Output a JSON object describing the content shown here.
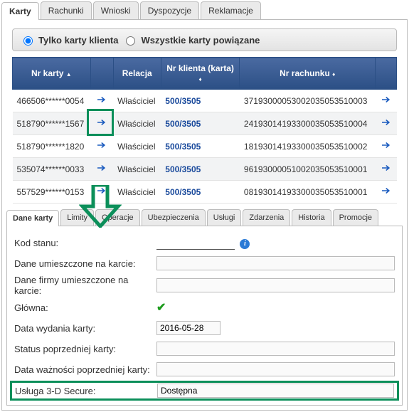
{
  "topTabs": {
    "karty": "Karty",
    "rachunki": "Rachunki",
    "wnioski": "Wnioski",
    "dyspozycje": "Dyspozycje",
    "reklamacje": "Reklamacje"
  },
  "filter": {
    "onlyClient": "Tylko karty klienta",
    "allLinked": "Wszystkie karty powiązane"
  },
  "table": {
    "headers": {
      "cardNo": "Nr karty",
      "relation": "Relacja",
      "clientNo": "Nr klienta (karta)",
      "accountNo": "Nr rachunku"
    },
    "rows": [
      {
        "card": "466506******0054",
        "relation": "Właściciel",
        "client": "500/3505",
        "account": "37193000053002035053510003"
      },
      {
        "card": "518790******1567",
        "relation": "Właściciel",
        "client": "500/3505",
        "account": "24193014193300035053510004"
      },
      {
        "card": "518790******1820",
        "relation": "Właściciel",
        "client": "500/3505",
        "account": "18193014193300035053510002"
      },
      {
        "card": "535074******0033",
        "relation": "Właściciel",
        "client": "500/3505",
        "account": "96193000051002035053510001"
      },
      {
        "card": "557529******0153",
        "relation": "Właściciel",
        "client": "500/3505",
        "account": "08193014193300035053510001"
      }
    ]
  },
  "detailTabs": {
    "daneKarty": "Dane karty",
    "limity": "Limity",
    "operacje": "Operacje",
    "ubezpieczenia": "Ubezpieczenia",
    "uslugi": "Usługi",
    "zdarzenia": "Zdarzenia",
    "historia": "Historia",
    "promocje": "Promocje"
  },
  "details": {
    "kodStanu": {
      "label": "Kod stanu:",
      "value": ""
    },
    "daneKarcie": {
      "label": "Dane umieszczone na karcie:",
      "value": ""
    },
    "daneFirmy": {
      "label": "Dane firmy umieszczone na karcie:",
      "value": ""
    },
    "glowna": {
      "label": "Główna:",
      "value": "✔"
    },
    "dataWydania": {
      "label": "Data wydania karty:",
      "value": "2016-05-28"
    },
    "statusPoprzedniej": {
      "label": "Status poprzedniej karty:",
      "value": ""
    },
    "dataWaznosci": {
      "label": "Data ważności poprzedniej karty:",
      "value": ""
    },
    "secure": {
      "label": "Usługa 3-D Secure:",
      "value": "Dostępna"
    }
  }
}
